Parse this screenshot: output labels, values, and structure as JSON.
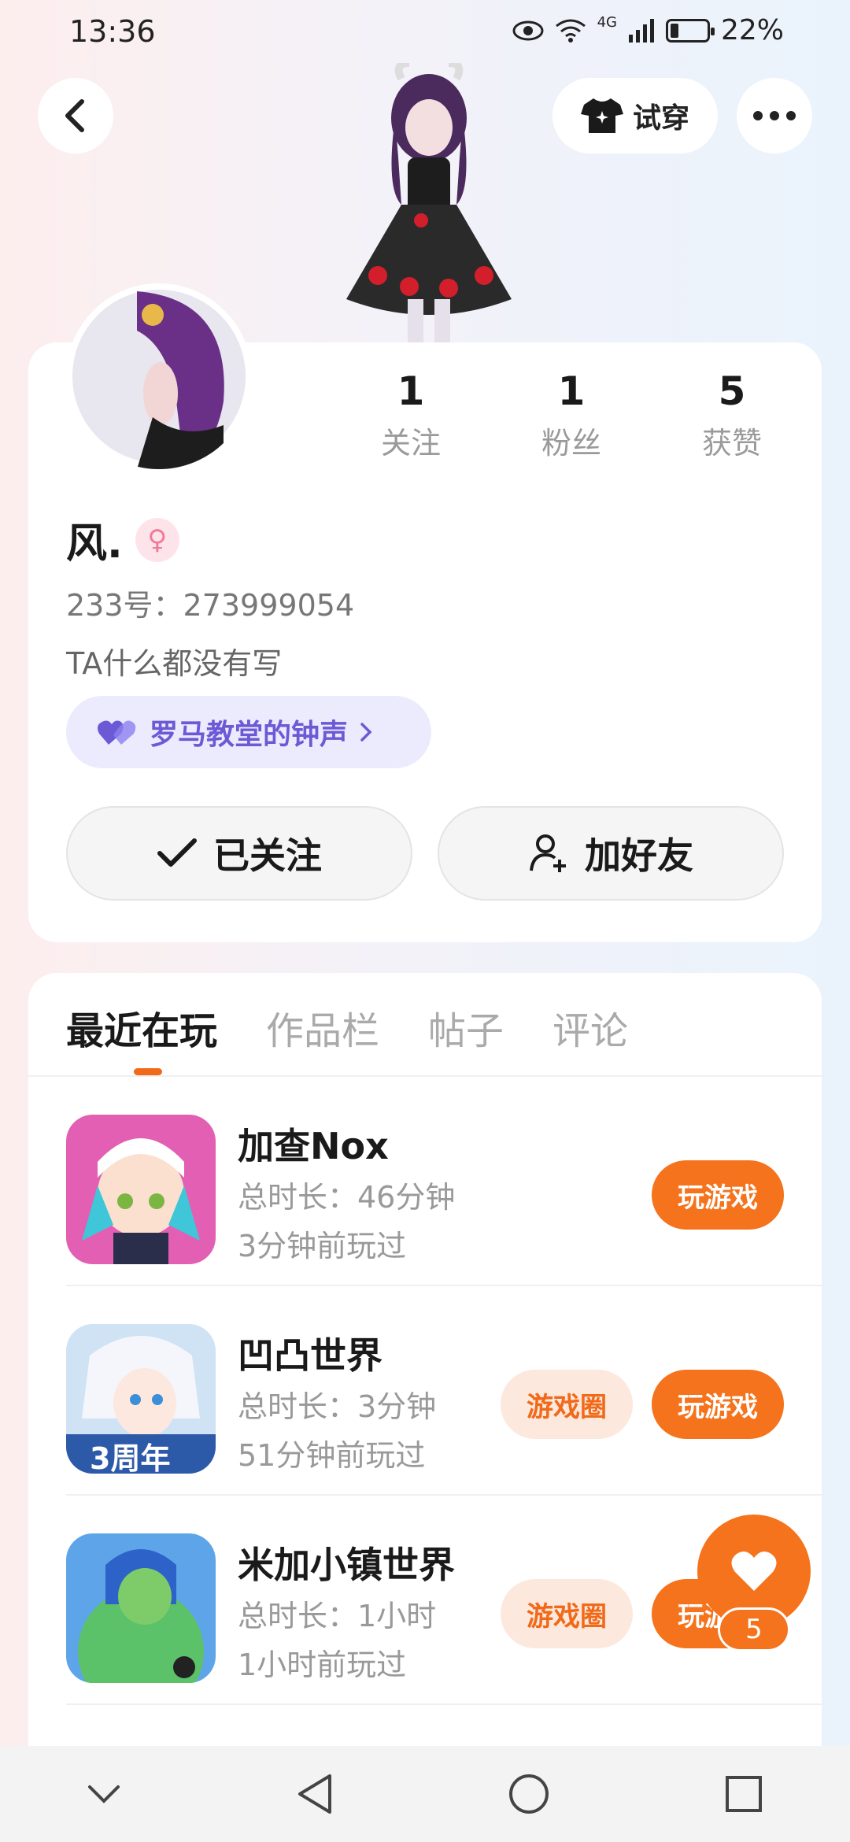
{
  "status_bar": {
    "time": "13:36",
    "network": "4G",
    "battery": "22%",
    "battery_level": 0.22
  },
  "header": {
    "try_on_label": "试穿"
  },
  "profile": {
    "stats": [
      {
        "value": "1",
        "label": "关注"
      },
      {
        "value": "1",
        "label": "粉丝"
      },
      {
        "value": "5",
        "label": "获赞"
      }
    ],
    "name": "风.",
    "gender_icon": "female-icon",
    "uid": "233号：273999054",
    "bio": "TA什么都没有写",
    "tag_label": "罗马教堂的钟声",
    "followed_label": "已关注",
    "add_friend_label": "加好友"
  },
  "tabs": [
    {
      "label": "最近在玩",
      "active": true
    },
    {
      "label": "作品栏"
    },
    {
      "label": "帖子"
    },
    {
      "label": "评论"
    }
  ],
  "games": [
    {
      "title": "加查Nox",
      "duration": "总时长：46分钟",
      "last_played": "3分钟前玩过",
      "play_label": "玩游戏"
    },
    {
      "title": "凹凸世界",
      "duration": "总时长：3分钟",
      "last_played": "51分钟前玩过",
      "circle_label": "游戏圈",
      "play_label": "玩游戏",
      "icon_badge": "3周年"
    },
    {
      "title": "米加小镇世界",
      "duration": "总时长：1小时",
      "last_played": "1小时前玩过",
      "circle_label": "游戏圈",
      "play_label": "玩游戏"
    }
  ],
  "like_fab": {
    "count": "5"
  },
  "colors": {
    "accent": "#f4731c",
    "tag_bg": "#ecebfd",
    "tag_text": "#6a5ad6",
    "gender": "#f17b98"
  }
}
